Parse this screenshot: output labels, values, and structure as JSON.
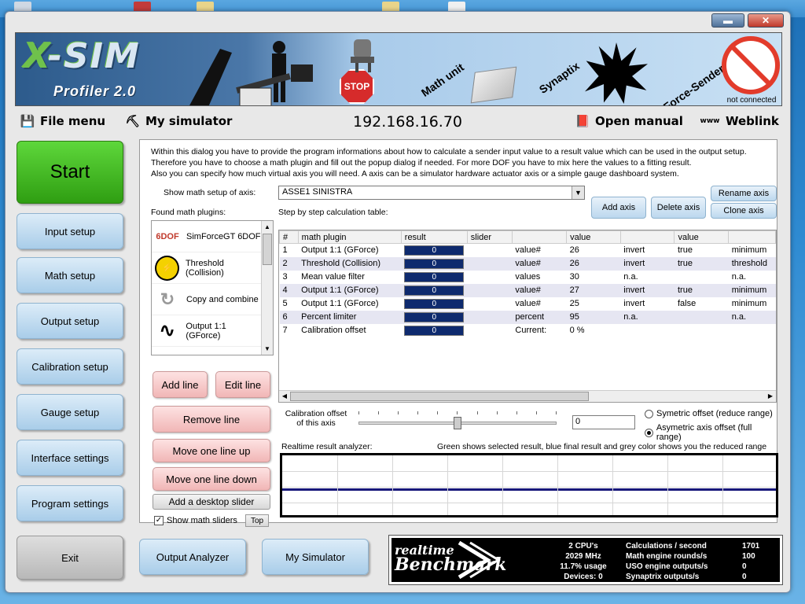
{
  "window": {
    "min_label": "▬",
    "close_label": "✕"
  },
  "banner": {
    "logo_x": "X",
    "logo_rest": "-SIM",
    "logo_sub": "Profiler 2.0",
    "stop_label": "STOP",
    "math_unit": "Math unit",
    "synaptix": "Synaptix",
    "force_sender": "Force-Sender",
    "status": "not connected"
  },
  "menu": {
    "file_menu": "File menu",
    "my_simulator": "My simulator",
    "ip": "192.168.16.70",
    "open_manual": "Open manual",
    "weblink": "Weblink"
  },
  "nav": {
    "start": "Start",
    "input_setup": "Input setup",
    "math_setup": "Math setup",
    "output_setup": "Output setup",
    "calibration_setup": "Calibration setup",
    "gauge_setup": "Gauge setup",
    "interface_settings": "Interface settings",
    "program_settings": "Program settings",
    "exit": "Exit",
    "output_analyzer": "Output Analyzer",
    "my_simulator": "My Simulator"
  },
  "math": {
    "intro_1": "Within this dialog you have to provide the program informations about how to calculate a sender input value to a result value which can be used in the output setup.",
    "intro_2": "Therefore you have to choose a math plugin and fill out the popup dialog if needed. For more DOF you have to mix here the values to a fitting result.",
    "intro_3": "Also you can specify how much virtual axis you will need. A axis can be a simulator hardware actuator axis or a simple gauge dashboard system.",
    "show_setup_label": "Show math setup of axis:",
    "axis_value": "ASSE1 SINISTRA",
    "add_axis": "Add axis",
    "delete_axis": "Delete axis",
    "rename_axis": "Rename axis",
    "clone_axis": "Clone axis",
    "found_plugins_label": "Found math plugins:",
    "step_label": "Step by step calculation table:",
    "plugins": [
      {
        "name": "SimForceGT 6DOF",
        "icon": "6DOF"
      },
      {
        "name": "Threshold (Collision)",
        "icon": "⚡"
      },
      {
        "name": "Copy and combine",
        "icon": "↻"
      },
      {
        "name": "Output 1:1 (GForce)",
        "icon": "∿"
      }
    ],
    "add_line": "Add line",
    "edit_line": "Edit line",
    "remove_line": "Remove line",
    "move_up": "Move one line up",
    "move_down": "Move one line down",
    "add_slider": "Add a desktop slider",
    "show_sliders": "Show math sliders",
    "top": "Top",
    "table": {
      "headers": [
        "#",
        "math plugin",
        "result",
        "slider",
        "",
        "value",
        "",
        "value",
        ""
      ],
      "rows": [
        [
          "1",
          "Output 1:1 (GForce)",
          "0",
          "",
          "value#",
          "26",
          "invert",
          "true",
          "minimum"
        ],
        [
          "2",
          "Threshold (Collision)",
          "0",
          "",
          "value#",
          "26",
          "invert",
          "true",
          "threshold"
        ],
        [
          "3",
          "Mean value filter",
          "0",
          "",
          "values",
          "30",
          "n.a.",
          "",
          "n.a."
        ],
        [
          "4",
          "Output 1:1 (GForce)",
          "0",
          "",
          "value#",
          "27",
          "invert",
          "true",
          "minimum"
        ],
        [
          "5",
          "Output 1:1 (GForce)",
          "0",
          "",
          "value#",
          "25",
          "invert",
          "false",
          "minimum"
        ],
        [
          "6",
          "Percent limiter",
          "0",
          "",
          "percent",
          "95",
          "n.a.",
          "",
          "n.a."
        ],
        [
          "7",
          "Calibration offset",
          "0",
          "",
          "Current:",
          "0 %",
          "",
          "",
          ""
        ]
      ]
    },
    "calib_label_1": "Calibration offset",
    "calib_label_2": "of this axis",
    "calib_value": "0",
    "calib_slider_position": 0.5,
    "radio_symmetric": "Symetric offset (reduce range)",
    "radio_asymmetric": "Asymetric axis offset (full range)",
    "analyzer_label": "Realtime result analyzer:",
    "analyzer_hint": "Green shows selected result, blue final result and grey color shows you the reduced range"
  },
  "bench": {
    "logo_top": "realtime",
    "logo_bottom": "Benchmark",
    "cpus": "2 CPU's",
    "mhz": "2029 MHz",
    "usage": "11.7% usage",
    "devices": "Devices: 0",
    "calc_label": "Calculations / second",
    "math_label": "Math engine rounds/s",
    "uso_label": "USO engine outputs/s",
    "syn_label": "Synaptrix outputs/s",
    "calc_val": "1701",
    "math_val": "100",
    "uso_val": "0",
    "syn_val": "0"
  },
  "colors": {
    "start_green": "#3fbf1f",
    "nav_blue": "#bcd8ee",
    "action_pink": "#f1b6b6",
    "result_bar": "#0e2a6e",
    "stop_red": "#d62b2b"
  }
}
